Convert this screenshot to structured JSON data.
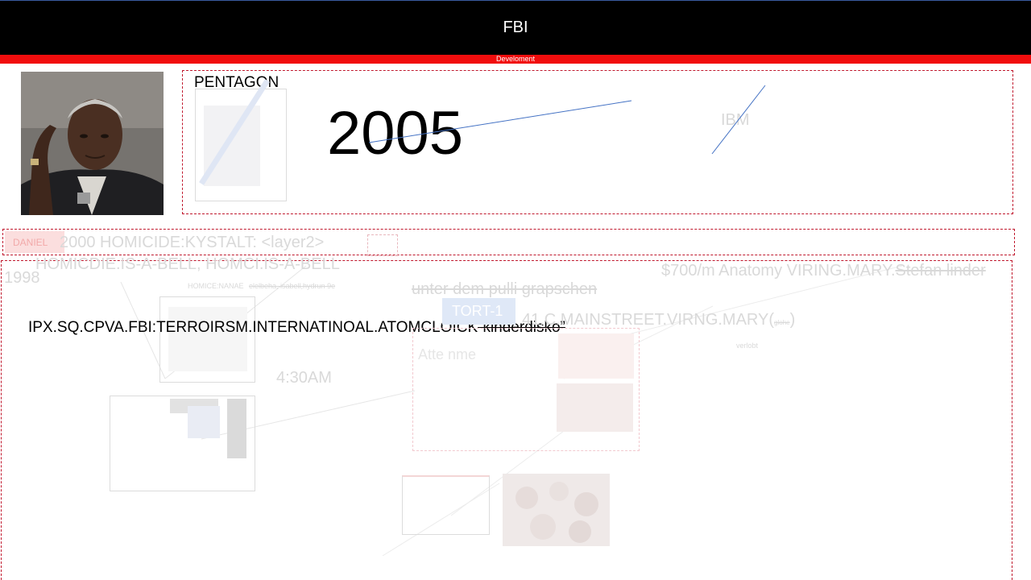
{
  "header": {
    "title": "FBI",
    "banner": "Develoment"
  },
  "top_panel": {
    "heading": "PENTAGON",
    "year": "2005",
    "faint_label": "IBM"
  },
  "strip": {
    "tag": "DANIEL",
    "text": "2000 HOMICIDE:KYSTALT: <layer2>"
  },
  "board": {
    "line1": "HOMICDIE.IS-A-BELL, HOMCI.IS-A-BELL",
    "year_left": "1998",
    "small_caption_a": "HOMICE:NANAE",
    "small_caption_b": "elelbeha, isabell,hydrun 9e",
    "main_text": "IPX.SQ.CPVA.FBI:TERROIRSM.INTERNATINOAL.ATOMCLOICK",
    "main_struck": "”kinderdisko”",
    "time": "4:30AM",
    "phrase": "unter dem pulli grapschen",
    "tort": "TORT-1",
    "street_prefix": "41.C.MAINSTREET.VIRNG.MARY(",
    "street_small": "glohe",
    "street_suffix": ")",
    "street_sub": "verlobt",
    "right_text": "$700/m  Anatomy VIRING.MARY.",
    "right_struck": "Stefan linder",
    "inner_faint": "Atte nme"
  },
  "colors": {
    "topbar": "#000000",
    "banner": "#f10d0d",
    "dash_border": "#c0182d",
    "line": "#4472c4"
  }
}
